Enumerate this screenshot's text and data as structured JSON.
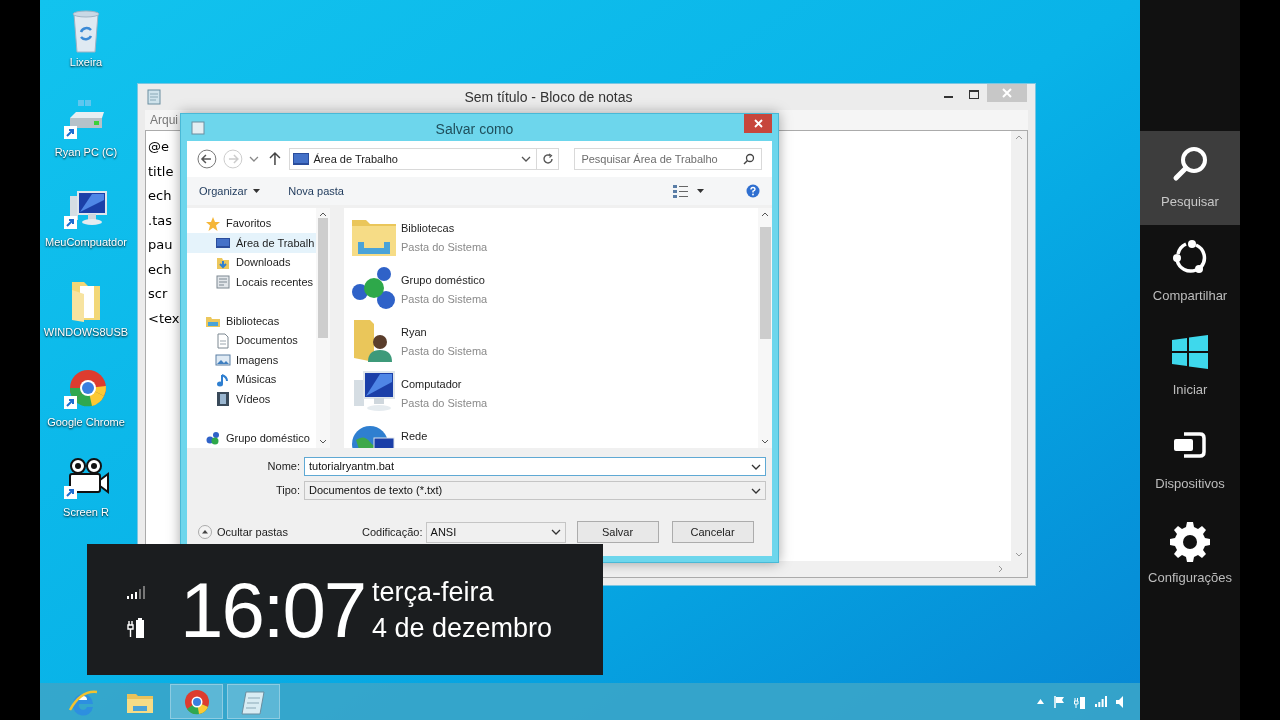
{
  "desktop_icons": [
    {
      "label": "Lixeira",
      "kind": "recycle"
    },
    {
      "label": "Ryan PC (C)",
      "kind": "drive"
    },
    {
      "label": "MeuCompuatdor",
      "kind": "computer"
    },
    {
      "label": "WINDOWS8USB",
      "kind": "folder"
    },
    {
      "label": "Google Chrome",
      "kind": "browser"
    },
    {
      "label": "Screen R",
      "kind": "camera"
    }
  ],
  "notepad": {
    "title": "Sem título - Bloco de notas",
    "menu": [
      "Arqui"
    ],
    "lines": [
      "@e",
      "title",
      "ech",
      ".tas",
      "pau",
      "ech",
      "scr",
      "<tex"
    ]
  },
  "dialog": {
    "title": "Salvar como",
    "address": "Área de Trabalho",
    "search": {
      "placeholder": "Pesquisar Área de Trabalho"
    },
    "toolbar": [
      "Organizar",
      "Nova pasta"
    ],
    "nav": [
      {
        "label": "Favoritos",
        "kind": "star",
        "selected": false,
        "children": [
          {
            "label": "Área de Trabalh",
            "kind": "desktop",
            "selected": true
          },
          {
            "label": "Downloads",
            "kind": "downloads",
            "selected": false
          },
          {
            "label": "Locais recentes",
            "kind": "recent",
            "selected": false
          }
        ]
      },
      {
        "label": "Bibliotecas",
        "kind": "library",
        "selected": false,
        "children": [
          {
            "label": "Documentos",
            "kind": "document",
            "selected": false
          },
          {
            "label": "Imagens",
            "kind": "image",
            "selected": false
          },
          {
            "label": "Músicas",
            "kind": "music",
            "selected": false
          },
          {
            "label": "Vídeos",
            "kind": "video",
            "selected": false
          }
        ]
      },
      {
        "label": "Grupo doméstico",
        "kind": "homegroup",
        "selected": false
      }
    ],
    "files": [
      {
        "name": "Bibliotecas",
        "type": "Pasta do Sistema",
        "kind": "library"
      },
      {
        "name": "Grupo doméstico",
        "type": "Pasta do Sistema",
        "kind": "homegroup"
      },
      {
        "name": "Ryan",
        "type": "Pasta do Sistema",
        "kind": "user"
      },
      {
        "name": "Computador",
        "type": "Pasta do Sistema",
        "kind": "computer"
      },
      {
        "name": "Rede",
        "kind": "network"
      }
    ],
    "name_field": {
      "label": "Nome:",
      "value": "tutorialryantm.bat"
    },
    "type_field": {
      "label": "Tipo:",
      "value": "Documentos de texto (*.txt)"
    },
    "hide_folders": "Ocultar pastas",
    "encoding": {
      "label": "Codificação:",
      "value": "ANSI"
    },
    "buttons": [
      "Salvar",
      "Cancelar"
    ]
  },
  "clock": {
    "time": "16:07",
    "day": "terça-feira",
    "date": "4 de dezembro"
  },
  "taskbar": {
    "apps": [
      {
        "kind": "ie",
        "active": false
      },
      {
        "kind": "explorer",
        "active": false
      },
      {
        "kind": "browser",
        "active": true
      },
      {
        "kind": "notepad",
        "active": true
      }
    ]
  },
  "charms": [
    {
      "label": "Pesquisar",
      "kind": "search",
      "selected": true
    },
    {
      "label": "Compartilhar",
      "kind": "share",
      "selected": false
    },
    {
      "label": "Iniciar",
      "kind": "start",
      "selected": false
    },
    {
      "label": "Dispositivos",
      "kind": "devices",
      "selected": false
    },
    {
      "label": "Configurações",
      "kind": "settings",
      "selected": false
    }
  ]
}
